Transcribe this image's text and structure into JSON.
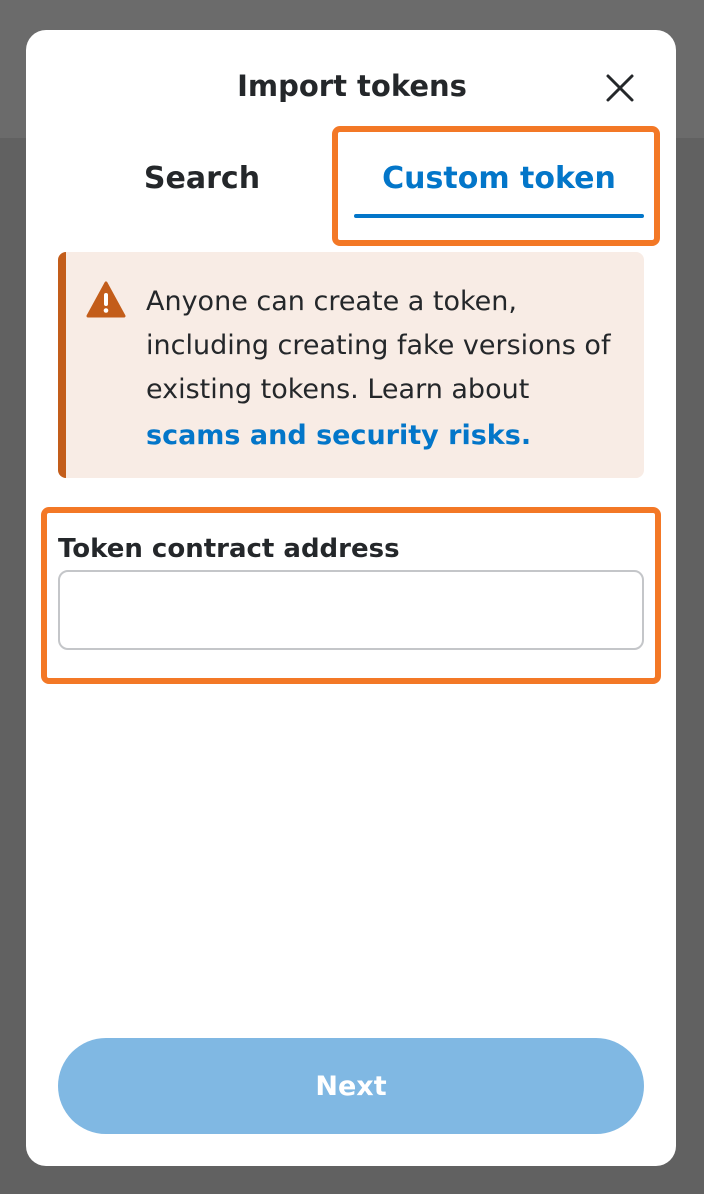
{
  "modal": {
    "title": "Import tokens",
    "close_icon": "close-icon"
  },
  "tabs": [
    {
      "label": "Search",
      "active": false
    },
    {
      "label": "Custom token",
      "active": true
    }
  ],
  "warning": {
    "icon": "warning-icon",
    "text": "Anyone can create a token, including creating fake versions of existing tokens. Learn about",
    "link_text": "scams and security risks."
  },
  "field": {
    "label": "Token contract address",
    "value": "",
    "placeholder": ""
  },
  "next_button": {
    "label": "Next",
    "disabled": true
  },
  "colors": {
    "accent": "#0376c9",
    "highlight": "#f37826",
    "warning_bar": "#c35d1a",
    "warning_bg": "#f8ece5",
    "button_disabled": "#80b8e3"
  }
}
